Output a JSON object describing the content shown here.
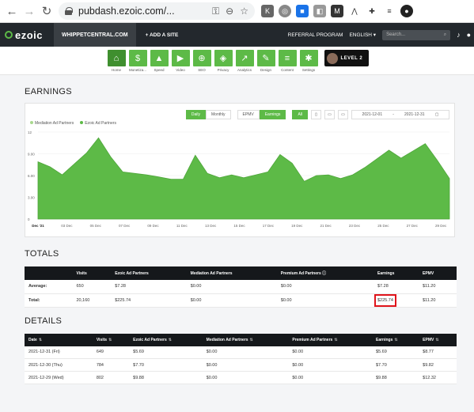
{
  "browser": {
    "url": "pubdash.ezoic.com/..."
  },
  "topnav": {
    "logo": "ezoic",
    "site": "WHIPPETCENTRAL.COM",
    "add_site": "+ ADD A SITE",
    "referral": "REFERRAL PROGRAM",
    "language": "ENGLISH ▾",
    "search_placeholder": "Search..."
  },
  "iconnav": {
    "items": [
      {
        "label": "Home",
        "icon": "home-icon",
        "glyph": "⌂"
      },
      {
        "label": "Monetiza...",
        "icon": "dollar-icon",
        "glyph": "$"
      },
      {
        "label": "Speed",
        "icon": "rocket-icon",
        "glyph": "▲"
      },
      {
        "label": "Video",
        "icon": "video-icon",
        "glyph": "▶"
      },
      {
        "label": "SEO",
        "icon": "magnifier-icon",
        "glyph": "⊕"
      },
      {
        "label": "Privacy",
        "icon": "shield-icon",
        "glyph": "◈"
      },
      {
        "label": "Analytics",
        "icon": "analytics-icon",
        "glyph": "↗"
      },
      {
        "label": "Design",
        "icon": "design-icon",
        "glyph": "✎"
      },
      {
        "label": "Content",
        "icon": "content-icon",
        "glyph": "≡"
      },
      {
        "label": "Settings",
        "icon": "gear-icon",
        "glyph": "✱"
      }
    ],
    "level": "LEVEL 2"
  },
  "earnings": {
    "title": "EARNINGS",
    "controls": {
      "daily": "Daily",
      "monthly": "Monthly",
      "epmv": "EPMV",
      "earnings": "Earnings",
      "all": "All",
      "start": "2021-12-01",
      "end": "2021-12-31"
    }
  },
  "chart_data": {
    "type": "area",
    "series": [
      {
        "name": "Mediation Ad Partners",
        "color": "#a8d88e",
        "values": [
          0,
          0,
          0,
          0,
          0,
          0,
          0,
          0,
          0,
          0,
          0,
          0,
          0,
          0,
          0,
          0,
          0,
          0,
          0,
          0,
          0,
          0,
          0,
          0,
          0,
          0,
          0,
          0,
          0,
          0,
          0
        ]
      },
      {
        "name": "Ezoic Ad Partners",
        "color": "#5dba47",
        "values": [
          7.9,
          7.2,
          6.1,
          7.6,
          9.1,
          11.2,
          8.6,
          6.5,
          6.3,
          6.1,
          5.8,
          5.5,
          5.5,
          8.8,
          6.3,
          5.7,
          6.1,
          5.7,
          6.1,
          6.5,
          8.9,
          7.7,
          5.2,
          6.0,
          6.1,
          5.6,
          6.1,
          7.1,
          8.3,
          9.5,
          8.4,
          9.4,
          10.4,
          8.1,
          5.6
        ]
      }
    ],
    "x_tick_labels": [
      "Dec '21",
      "03 Dec",
      "05 Dec",
      "07 Dec",
      "09 Dec",
      "11 Dec",
      "13 Dec",
      "15 Dec",
      "17 Dec",
      "19 Dec",
      "21 Dec",
      "23 Dec",
      "25 Dec",
      "27 Dec",
      "29 Dec"
    ],
    "y_tick_labels": [
      "0",
      "3.00",
      "6.00",
      "9.00",
      "12"
    ],
    "ylim": [
      0,
      12
    ],
    "grid": true
  },
  "totals": {
    "title": "TOTALS",
    "headers": [
      "",
      "Visits",
      "Ezoic Ad Partners",
      "Mediation Ad Partners",
      "Premium Ad Partners ⓘ",
      "Earnings",
      "EPMV"
    ],
    "rows": [
      [
        "Average:",
        "650",
        "$7.28",
        "$0.00",
        "$0.00",
        "$7.28",
        "$11.20"
      ],
      [
        "Total:",
        "20,160",
        "$225.74",
        "$0.00",
        "$0.00",
        "$225.74",
        "$11.20"
      ]
    ]
  },
  "details": {
    "title": "DETAILS",
    "headers": [
      "Date",
      "Visits",
      "Ezoic Ad Partners",
      "Mediation Ad Partners",
      "Premium Ad Partners",
      "Earnings",
      "EPMV"
    ],
    "rows": [
      [
        "2021-12-31 (Fri)",
        "649",
        "$5.69",
        "$0.00",
        "$0.00",
        "$5.69",
        "$8.77"
      ],
      [
        "2021-12-30 (Thu)",
        "784",
        "$7.70",
        "$0.00",
        "$0.00",
        "$7.70",
        "$9.82"
      ],
      [
        "2021-12-29 (Wed)",
        "802",
        "$9.88",
        "$0.00",
        "$0.00",
        "$9.88",
        "$12.32"
      ]
    ]
  }
}
